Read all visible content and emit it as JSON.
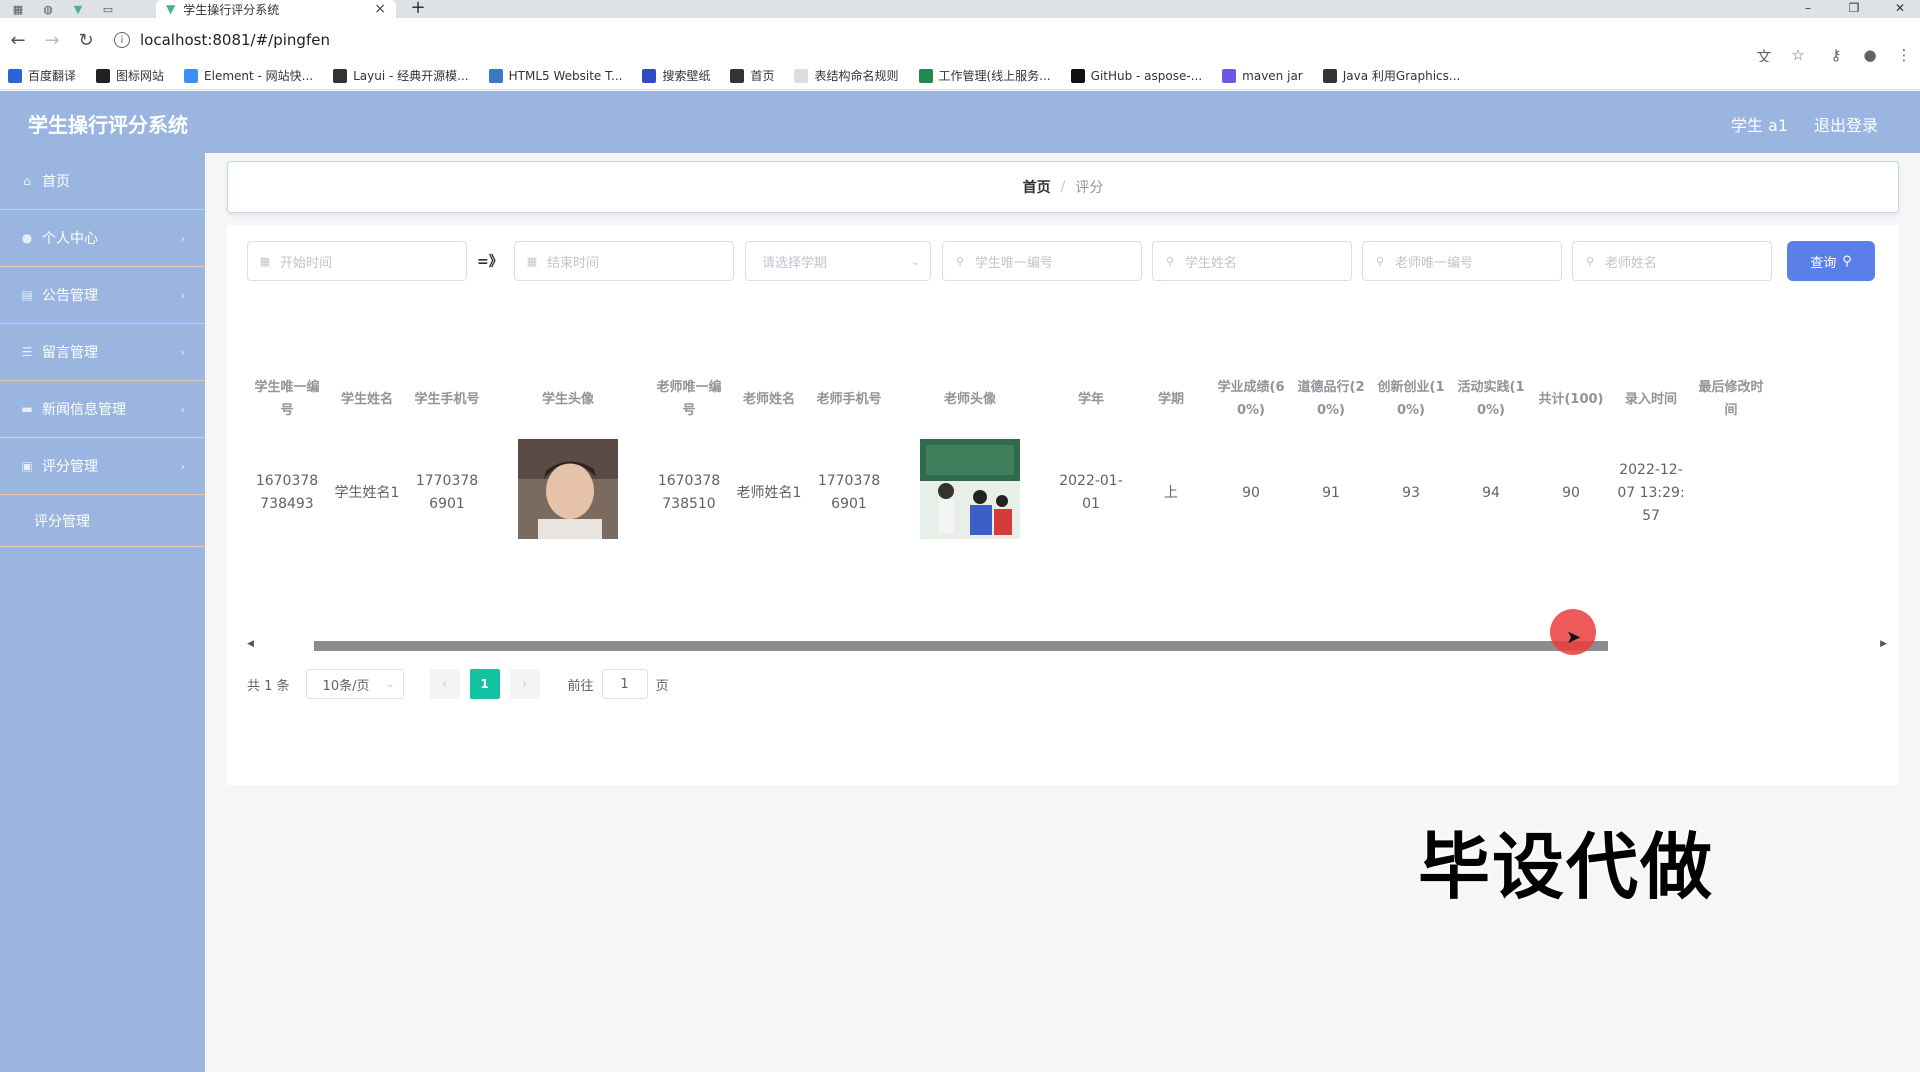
{
  "browser": {
    "tab_title": "学生操行评分系统",
    "url": "localhost:8081/#/pingfen",
    "bookmarks": [
      {
        "label": "百度翻译",
        "color": "#2a64d6"
      },
      {
        "label": "图标网站",
        "color": "#222222"
      },
      {
        "label": "Element - 网站快...",
        "color": "#3e8ff5"
      },
      {
        "label": "Layui - 经典开源模...",
        "color": "#333333"
      },
      {
        "label": "HTML5 Website T...",
        "color": "#3a78c2"
      },
      {
        "label": "搜索壁纸",
        "color": "#2d4cc4"
      },
      {
        "label": "首页",
        "color": "#333333"
      },
      {
        "label": "表结构命名规则",
        "color": "#dddddd"
      },
      {
        "label": "工作管理(线上服务...",
        "color": "#1f8a4c"
      },
      {
        "label": "GitHub - aspose-...",
        "color": "#111111"
      },
      {
        "label": "maven jar",
        "color": "#6a5ae0"
      },
      {
        "label": "Java 利用Graphics...",
        "color": "#333333"
      }
    ]
  },
  "header": {
    "title": "学生操行评分系统",
    "user": "学生 a1",
    "logout": "退出登录"
  },
  "sidebar": {
    "items": [
      {
        "label": "首页",
        "icon": "home-icon"
      },
      {
        "label": "个人中心",
        "icon": "user-icon"
      },
      {
        "label": "公告管理",
        "icon": "notice-icon"
      },
      {
        "label": "留言管理",
        "icon": "message-icon"
      },
      {
        "label": "新闻信息管理",
        "icon": "news-icon"
      },
      {
        "label": "评分管理",
        "icon": "score-icon"
      }
    ],
    "sub_item": "评分管理"
  },
  "breadcrumb": {
    "home": "首页",
    "separator": "/",
    "current": "评分"
  },
  "filters": {
    "start_time": "开始时间",
    "range_separator": "=》",
    "end_time": "结束时间",
    "semester": "请选择学期",
    "student_id": "学生唯一编号",
    "student_name": "学生姓名",
    "teacher_id": "老师唯一编号",
    "teacher_name": "老师姓名",
    "query": "查询"
  },
  "table": {
    "columns": [
      "学生唯一编号",
      "学生姓名",
      "学生手机号",
      "学生头像",
      "老师唯一编号",
      "老师姓名",
      "老师手机号",
      "老师头像",
      "学年",
      "学期",
      "学业成绩(60%)",
      "道德品行(20%)",
      "创新创业(10%)",
      "活动实践(10%)",
      "共计(100)",
      "录入时间",
      "最后修改时间"
    ],
    "rows": [
      {
        "student_id": "1670378738493",
        "student_name": "学生姓名1",
        "student_phone": "17703786901",
        "teacher_id": "1670378738510",
        "teacher_name": "老师姓名1",
        "teacher_phone": "17703786901",
        "school_year": "2022-01-01",
        "semester": "上",
        "academic": "90",
        "moral": "91",
        "innovation": "93",
        "activity": "94",
        "total": "90",
        "entry_time": "2022-12-07 13:29:57",
        "modified_time": ""
      }
    ]
  },
  "pagination": {
    "total": "共 1 条",
    "page_size": "10条/页",
    "current_page": "1",
    "goto_label": "前往",
    "goto_value": "1",
    "page_unit": "页"
  },
  "watermark": "毕设代做",
  "colors": {
    "header_bg": "#9ab5e0",
    "query_btn": "#5b7fe8",
    "active_page": "#13c2a0"
  }
}
